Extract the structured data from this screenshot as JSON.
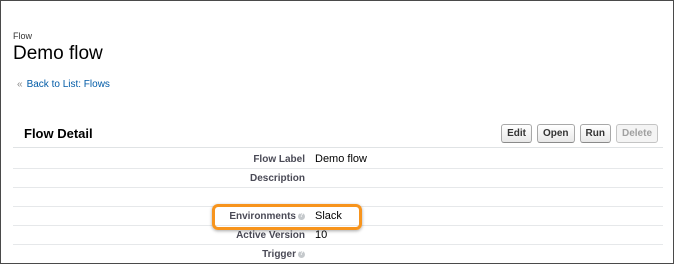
{
  "header": {
    "type_label": "Flow",
    "title": "Demo flow"
  },
  "backlink": {
    "chevron": "«",
    "text": "Back to List: Flows"
  },
  "detail": {
    "section_title": "Flow Detail",
    "buttons": {
      "edit": "Edit",
      "open": "Open",
      "run": "Run",
      "delete": "Delete"
    },
    "fields": [
      {
        "label": "Flow Label",
        "value": "Demo flow",
        "help": false
      },
      {
        "label": "Description",
        "value": "",
        "help": false
      },
      {
        "label": "",
        "value": "",
        "help": false
      },
      {
        "label": "Environments",
        "value": "Slack",
        "help": true
      },
      {
        "label": "Active Version",
        "value": "10",
        "help": false
      },
      {
        "label": "Trigger",
        "value": "",
        "help": true
      }
    ]
  },
  "colors": {
    "highlight": "#f7941d",
    "link": "#015ba7"
  },
  "icons": {
    "help": "help-icon",
    "chevron": "double-chevron-left-icon"
  }
}
